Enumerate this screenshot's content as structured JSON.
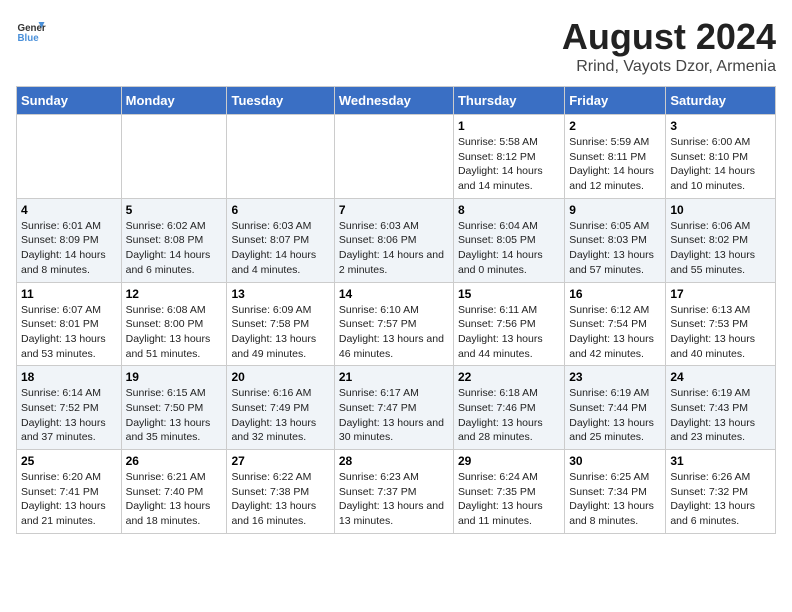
{
  "header": {
    "logo_text_general": "General",
    "logo_text_blue": "Blue",
    "main_title": "August 2024",
    "subtitle": "Rrind, Vayots Dzor, Armenia"
  },
  "columns": [
    "Sunday",
    "Monday",
    "Tuesday",
    "Wednesday",
    "Thursday",
    "Friday",
    "Saturday"
  ],
  "weeks": [
    [
      {
        "day": "",
        "info": ""
      },
      {
        "day": "",
        "info": ""
      },
      {
        "day": "",
        "info": ""
      },
      {
        "day": "",
        "info": ""
      },
      {
        "day": "1",
        "info": "Sunrise: 5:58 AM\nSunset: 8:12 PM\nDaylight: 14 hours and 14 minutes."
      },
      {
        "day": "2",
        "info": "Sunrise: 5:59 AM\nSunset: 8:11 PM\nDaylight: 14 hours and 12 minutes."
      },
      {
        "day": "3",
        "info": "Sunrise: 6:00 AM\nSunset: 8:10 PM\nDaylight: 14 hours and 10 minutes."
      }
    ],
    [
      {
        "day": "4",
        "info": "Sunrise: 6:01 AM\nSunset: 8:09 PM\nDaylight: 14 hours and 8 minutes."
      },
      {
        "day": "5",
        "info": "Sunrise: 6:02 AM\nSunset: 8:08 PM\nDaylight: 14 hours and 6 minutes."
      },
      {
        "day": "6",
        "info": "Sunrise: 6:03 AM\nSunset: 8:07 PM\nDaylight: 14 hours and 4 minutes."
      },
      {
        "day": "7",
        "info": "Sunrise: 6:03 AM\nSunset: 8:06 PM\nDaylight: 14 hours and 2 minutes."
      },
      {
        "day": "8",
        "info": "Sunrise: 6:04 AM\nSunset: 8:05 PM\nDaylight: 14 hours and 0 minutes."
      },
      {
        "day": "9",
        "info": "Sunrise: 6:05 AM\nSunset: 8:03 PM\nDaylight: 13 hours and 57 minutes."
      },
      {
        "day": "10",
        "info": "Sunrise: 6:06 AM\nSunset: 8:02 PM\nDaylight: 13 hours and 55 minutes."
      }
    ],
    [
      {
        "day": "11",
        "info": "Sunrise: 6:07 AM\nSunset: 8:01 PM\nDaylight: 13 hours and 53 minutes."
      },
      {
        "day": "12",
        "info": "Sunrise: 6:08 AM\nSunset: 8:00 PM\nDaylight: 13 hours and 51 minutes."
      },
      {
        "day": "13",
        "info": "Sunrise: 6:09 AM\nSunset: 7:58 PM\nDaylight: 13 hours and 49 minutes."
      },
      {
        "day": "14",
        "info": "Sunrise: 6:10 AM\nSunset: 7:57 PM\nDaylight: 13 hours and 46 minutes."
      },
      {
        "day": "15",
        "info": "Sunrise: 6:11 AM\nSunset: 7:56 PM\nDaylight: 13 hours and 44 minutes."
      },
      {
        "day": "16",
        "info": "Sunrise: 6:12 AM\nSunset: 7:54 PM\nDaylight: 13 hours and 42 minutes."
      },
      {
        "day": "17",
        "info": "Sunrise: 6:13 AM\nSunset: 7:53 PM\nDaylight: 13 hours and 40 minutes."
      }
    ],
    [
      {
        "day": "18",
        "info": "Sunrise: 6:14 AM\nSunset: 7:52 PM\nDaylight: 13 hours and 37 minutes."
      },
      {
        "day": "19",
        "info": "Sunrise: 6:15 AM\nSunset: 7:50 PM\nDaylight: 13 hours and 35 minutes."
      },
      {
        "day": "20",
        "info": "Sunrise: 6:16 AM\nSunset: 7:49 PM\nDaylight: 13 hours and 32 minutes."
      },
      {
        "day": "21",
        "info": "Sunrise: 6:17 AM\nSunset: 7:47 PM\nDaylight: 13 hours and 30 minutes."
      },
      {
        "day": "22",
        "info": "Sunrise: 6:18 AM\nSunset: 7:46 PM\nDaylight: 13 hours and 28 minutes."
      },
      {
        "day": "23",
        "info": "Sunrise: 6:19 AM\nSunset: 7:44 PM\nDaylight: 13 hours and 25 minutes."
      },
      {
        "day": "24",
        "info": "Sunrise: 6:19 AM\nSunset: 7:43 PM\nDaylight: 13 hours and 23 minutes."
      }
    ],
    [
      {
        "day": "25",
        "info": "Sunrise: 6:20 AM\nSunset: 7:41 PM\nDaylight: 13 hours and 21 minutes."
      },
      {
        "day": "26",
        "info": "Sunrise: 6:21 AM\nSunset: 7:40 PM\nDaylight: 13 hours and 18 minutes."
      },
      {
        "day": "27",
        "info": "Sunrise: 6:22 AM\nSunset: 7:38 PM\nDaylight: 13 hours and 16 minutes."
      },
      {
        "day": "28",
        "info": "Sunrise: 6:23 AM\nSunset: 7:37 PM\nDaylight: 13 hours and 13 minutes."
      },
      {
        "day": "29",
        "info": "Sunrise: 6:24 AM\nSunset: 7:35 PM\nDaylight: 13 hours and 11 minutes."
      },
      {
        "day": "30",
        "info": "Sunrise: 6:25 AM\nSunset: 7:34 PM\nDaylight: 13 hours and 8 minutes."
      },
      {
        "day": "31",
        "info": "Sunrise: 6:26 AM\nSunset: 7:32 PM\nDaylight: 13 hours and 6 minutes."
      }
    ]
  ]
}
